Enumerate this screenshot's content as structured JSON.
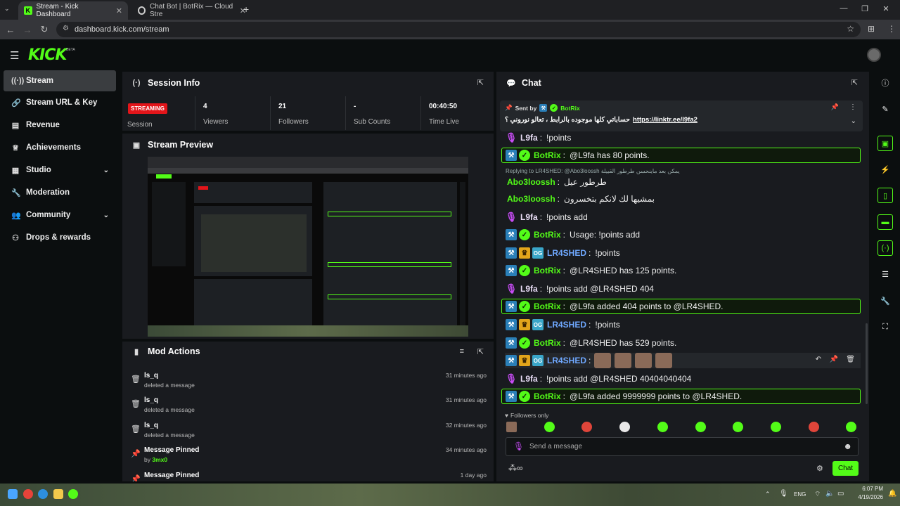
{
  "browser": {
    "tabs": [
      {
        "title": "Stream - Kick Dashboard",
        "active": true
      },
      {
        "title": "Chat Bot | BotRix — Cloud Stre",
        "active": false
      }
    ],
    "new_tab": "+",
    "url": "dashboard.kick.com/stream"
  },
  "app": {
    "logo": "KICK",
    "logo_badge": "BETA"
  },
  "sidebar": {
    "items": [
      {
        "label": "Stream",
        "icon": "broadcast-icon",
        "active": true
      },
      {
        "label": "Stream URL & Key",
        "icon": "link-icon"
      },
      {
        "label": "Revenue",
        "icon": "chart-icon"
      },
      {
        "label": "Achievements",
        "icon": "trophy-icon"
      },
      {
        "label": "Studio",
        "icon": "grid-icon",
        "expandable": true
      },
      {
        "label": "Moderation",
        "icon": "wrench-icon"
      },
      {
        "label": "Community",
        "icon": "users-icon",
        "expandable": true
      },
      {
        "label": "Drops & rewards",
        "icon": "gift-icon"
      }
    ]
  },
  "session": {
    "title": "Session Info",
    "status_badge": "STREAMING",
    "status_label": "Session",
    "stats": [
      {
        "value": "4",
        "label": "Viewers"
      },
      {
        "value": "21",
        "label": "Followers"
      },
      {
        "value": "-",
        "label": "Sub Counts"
      },
      {
        "value": "00:40:50",
        "label": "Time Live"
      }
    ]
  },
  "preview": {
    "title": "Stream Preview"
  },
  "mod_actions": {
    "title": "Mod Actions",
    "rows": [
      {
        "icon": "trash-icon",
        "title": "ls_q",
        "sub": "deleted a message",
        "time": "31 minutes ago"
      },
      {
        "icon": "trash-icon",
        "title": "ls_q",
        "sub": "deleted a message",
        "time": "31 minutes ago"
      },
      {
        "icon": "trash-icon",
        "title": "ls_q",
        "sub": "deleted a message",
        "time": "32 minutes ago"
      },
      {
        "icon": "pin-icon",
        "title": "Message Pinned",
        "sub_prefix": "by",
        "sub_user": "3mx0",
        "time": "34 minutes ago"
      },
      {
        "icon": "pin-icon",
        "title": "Message Pinned",
        "time": "1 day ago"
      }
    ]
  },
  "chat": {
    "title": "Chat",
    "pinned": {
      "sent_by": "Sent by",
      "user": "BotRix",
      "text": "حساباتي كلها موجوده بالرابط ، تعالو نوروني ؟",
      "link": "https://linktr.ee/l9fa2"
    },
    "reply_context": "Replying to LR4SHED: @Abo3loossh يمكن بعد ماينحسن طرطور القبيلة",
    "messages": [
      {
        "user": "L9fa",
        "badges": [
          "mic"
        ],
        "color": "#e8dcf5",
        "text": "!points",
        "hl": false
      },
      {
        "user": "BotRix",
        "badges": [
          "mod",
          "ver"
        ],
        "color": "#53fc18",
        "text": "@L9fa has 80 points.",
        "hl": true
      },
      {
        "user": "Abo3loossh",
        "badges": [],
        "color": "#53fc18",
        "text": "طرطور عيل",
        "hl": false
      },
      {
        "user": "Abo3loossh",
        "badges": [],
        "color": "#53fc18",
        "text": "بمشيها لك لانكم بتخسرون",
        "hl": false
      },
      {
        "user": "L9fa",
        "badges": [
          "mic"
        ],
        "color": "#e8dcf5",
        "text": "!points add",
        "hl": false
      },
      {
        "user": "BotRix",
        "badges": [
          "mod",
          "ver"
        ],
        "color": "#53fc18",
        "text": "Usage: !points add",
        "hl": false
      },
      {
        "user": "LR4SHED",
        "badges": [
          "mod",
          "crown",
          "og"
        ],
        "color": "#6fa8ff",
        "text": "!points",
        "hl": false
      },
      {
        "user": "BotRix",
        "badges": [
          "mod",
          "ver"
        ],
        "color": "#53fc18",
        "text": "@LR4SHED has 125 points.",
        "hl": false
      },
      {
        "user": "L9fa",
        "badges": [
          "mic"
        ],
        "color": "#e8dcf5",
        "text": "!points add @LR4SHED 404",
        "hl": false
      },
      {
        "user": "BotRix",
        "badges": [
          "mod",
          "ver"
        ],
        "color": "#53fc18",
        "text": "@L9fa added 404 points to @LR4SHED.",
        "hl": true
      },
      {
        "user": "LR4SHED",
        "badges": [
          "mod",
          "crown",
          "og"
        ],
        "color": "#6fa8ff",
        "text": "!points",
        "hl": false
      },
      {
        "user": "BotRix",
        "badges": [
          "mod",
          "ver"
        ],
        "color": "#53fc18",
        "text": "@LR4SHED has 529 points.",
        "hl": false
      },
      {
        "user": "LR4SHED",
        "badges": [
          "mod",
          "crown",
          "og"
        ],
        "color": "#6fa8ff",
        "text": "",
        "hl": false,
        "emotes": 4
      },
      {
        "user": "L9fa",
        "badges": [
          "mic"
        ],
        "color": "#e8dcf5",
        "text": "!points add @LR4SHED 40404040404",
        "hl": false
      },
      {
        "user": "BotRix",
        "badges": [
          "mod",
          "ver"
        ],
        "color": "#53fc18",
        "text": "@L9fa added 9999999 points to @LR4SHED.",
        "hl": true
      }
    ],
    "followers_only": "Followers only",
    "emote_bar_colors": [
      "#8a6a58",
      "#53fc18",
      "#e0453a",
      "#e8e8e8",
      "#53fc18",
      "#53fc18",
      "#53fc18",
      "#53fc18",
      "#e0453a",
      "#53fc18"
    ],
    "input_placeholder": "Send a message",
    "send_label": "Chat"
  },
  "taskbar": {
    "lang": "ENG",
    "time": "6:07 PM",
    "date": "4/19/2026"
  },
  "colors": {
    "accent": "#53fc18",
    "live": "#e3151a"
  }
}
